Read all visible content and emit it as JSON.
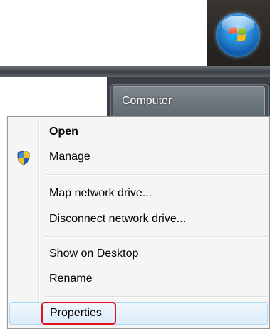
{
  "start_menu": {
    "computer_label": "Computer"
  },
  "context_menu": {
    "items": [
      {
        "label": "Open",
        "bold": true
      },
      {
        "label": "Manage",
        "icon": "uac-shield-icon"
      },
      {
        "label": "Map network drive..."
      },
      {
        "label": "Disconnect network drive..."
      },
      {
        "label": "Show on Desktop"
      },
      {
        "label": "Rename"
      },
      {
        "label": "Properties",
        "highlighted": true
      }
    ]
  },
  "colors": {
    "highlight_outline": "#e0101a",
    "hover_fill": "#dcecfb"
  }
}
